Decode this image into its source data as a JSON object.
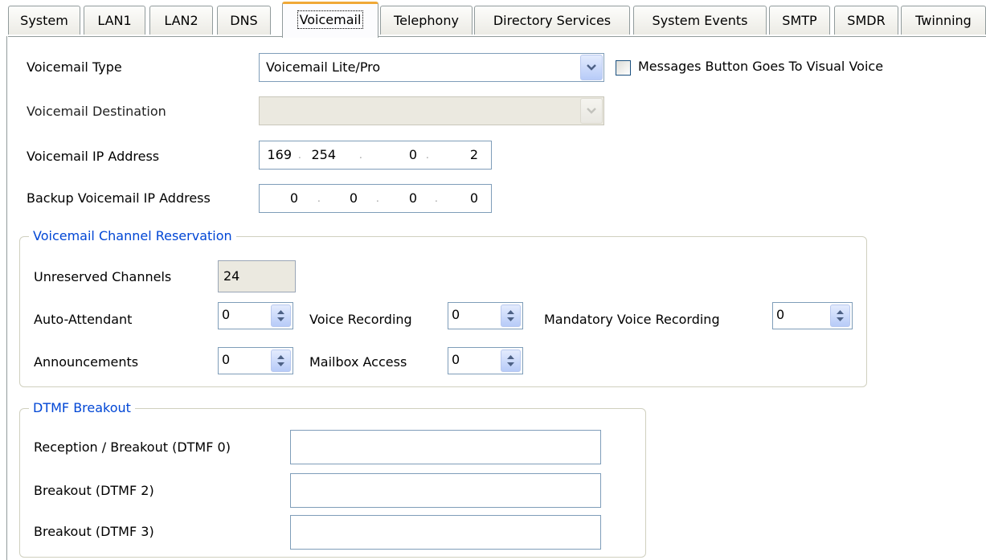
{
  "tabs": [
    {
      "label": "System"
    },
    {
      "label": "LAN1"
    },
    {
      "label": "LAN2"
    },
    {
      "label": "DNS"
    },
    {
      "label": "Voicemail"
    },
    {
      "label": "Telephony"
    },
    {
      "label": "Directory Services"
    },
    {
      "label": "System Events"
    },
    {
      "label": "SMTP"
    },
    {
      "label": "SMDR"
    },
    {
      "label": "Twinning"
    }
  ],
  "active_tab": "Voicemail",
  "voicemail_type": {
    "label": "Voicemail Type",
    "value": "Voicemail Lite/Pro"
  },
  "messages_button": {
    "label": "Messages Button Goes To Visual Voice",
    "checked": false
  },
  "voicemail_destination": {
    "label": "Voicemail Destination",
    "value": ""
  },
  "voicemail_ip": {
    "label": "Voicemail IP Address",
    "octets": [
      "169",
      "254",
      "0",
      "2"
    ]
  },
  "backup_ip": {
    "label": "Backup Voicemail IP Address",
    "octets": [
      "0",
      "0",
      "0",
      "0"
    ]
  },
  "channel_reservation": {
    "legend": "Voicemail Channel Reservation",
    "unreserved": {
      "label": "Unreserved Channels",
      "value": "24"
    },
    "auto_attendant": {
      "label": "Auto-Attendant",
      "value": "0"
    },
    "voice_recording": {
      "label": "Voice Recording",
      "value": "0"
    },
    "mandatory_voice_recording": {
      "label": "Mandatory Voice Recording",
      "value": "0"
    },
    "announcements": {
      "label": "Announcements",
      "value": "0"
    },
    "mailbox_access": {
      "label": "Mailbox Access",
      "value": "0"
    }
  },
  "dtmf_breakout": {
    "legend": "DTMF Breakout",
    "reception": {
      "label": "Reception / Breakout (DTMF 0)",
      "value": ""
    },
    "breakout2": {
      "label": "Breakout (DTMF 2)",
      "value": ""
    },
    "breakout3": {
      "label": "Breakout (DTMF 3)",
      "value": ""
    }
  }
}
